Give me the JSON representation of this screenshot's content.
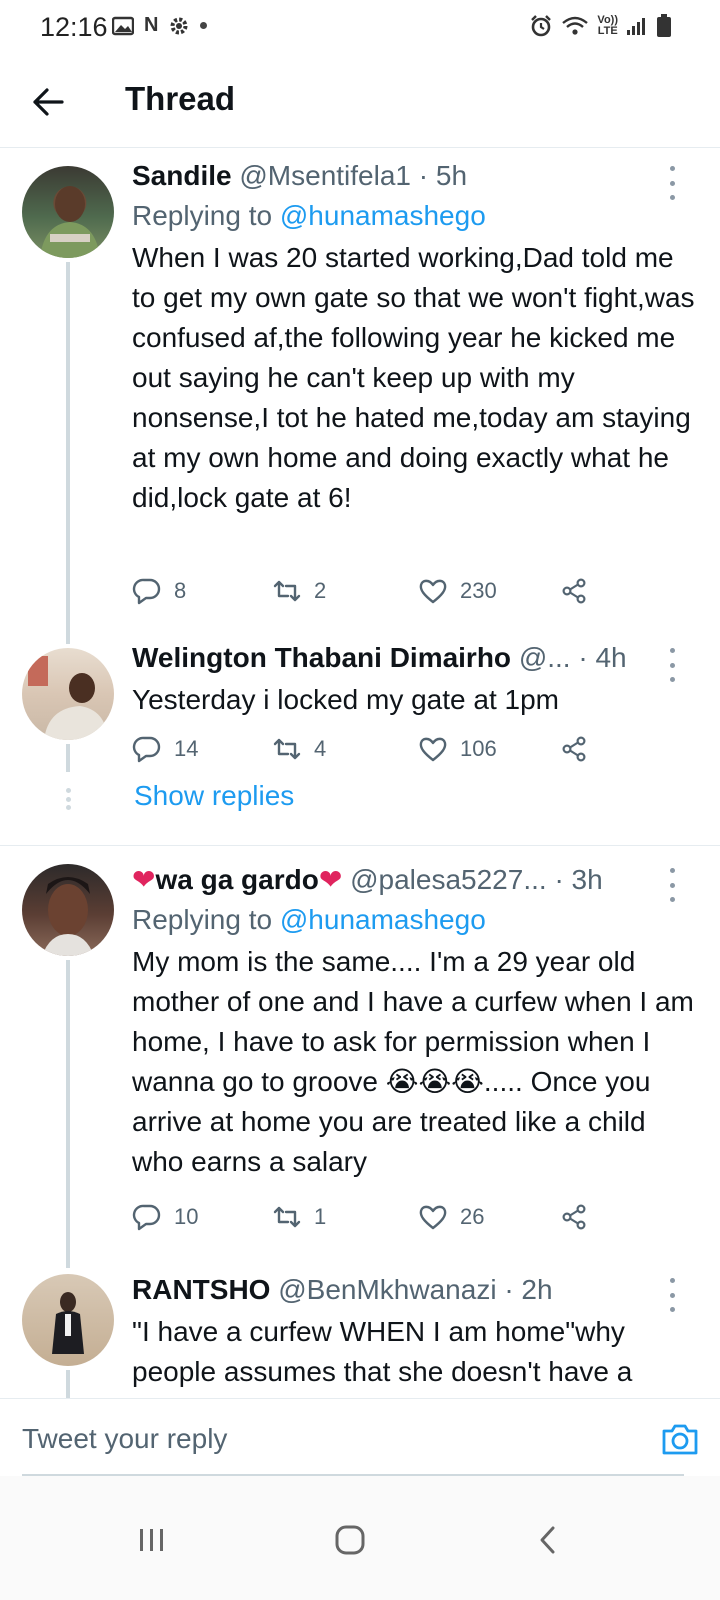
{
  "status_bar": {
    "time": "12:16",
    "left_icons": [
      "gallery-icon",
      "n-icon",
      "settings-gear-icon",
      "dot-icon"
    ],
    "n_glyph": "N",
    "right_icons": [
      "alarm-icon",
      "wifi-icon",
      "volte-icon",
      "signal-icon",
      "battery-icon"
    ],
    "volte_top": "Vo))",
    "volte_bottom": "LTE"
  },
  "header": {
    "title": "Thread"
  },
  "tweets": [
    {
      "name": "Sandile",
      "handle": "@Msentifela1",
      "time": "· 5h",
      "replying_prefix": "Replying to",
      "replying_to": "@hunamashego",
      "text": "When I was 20 started working,Dad told me to get my own gate so that we won't fight,was confused af,the following year he kicked me out saying he can't keep up with my nonsense,I tot he hated me,today am staying at my own home and doing exactly what he did,lock gate at 6!",
      "replies": "8",
      "retweets": "2",
      "likes": "230"
    },
    {
      "name": "Welington Thabani Dimairho",
      "handle": "@...",
      "time": "· 4h",
      "text": "Yesterday i locked my gate at 1pm",
      "replies": "14",
      "retweets": "4",
      "likes": "106"
    },
    {
      "name_emoji_left": "❤",
      "name": "wa ga gardo",
      "name_emoji_right": "❤",
      "handle": "@palesa5227...",
      "time": "· 3h",
      "replying_prefix": "Replying to",
      "replying_to": "@hunamashego",
      "text": "My mom is the same.... I'm a 29 year old mother of one and I have a curfew when I am home, I have to ask for permission when I wanna go to groove 😭😭😭..... Once you arrive at home you are treated like a child who earns a salary",
      "replies": "10",
      "retweets": "1",
      "likes": "26"
    },
    {
      "name": "RANTSHO",
      "handle": "@BenMkhwanazi",
      "time": "· 2h",
      "text": "\"I have a curfew WHEN I am home\"why people assumes that she doesn't have a"
    }
  ],
  "show_replies": "Show replies",
  "reply_bar": {
    "placeholder": "Tweet your reply",
    "camera_icon": "camera-icon"
  },
  "nav_bar": {
    "icons": [
      "recents-icon",
      "home-icon",
      "back-icon"
    ]
  },
  "colors": {
    "accent": "#1d9bf0",
    "text": "#0f1419",
    "secondary": "#536471",
    "heart": "#e0245e"
  }
}
